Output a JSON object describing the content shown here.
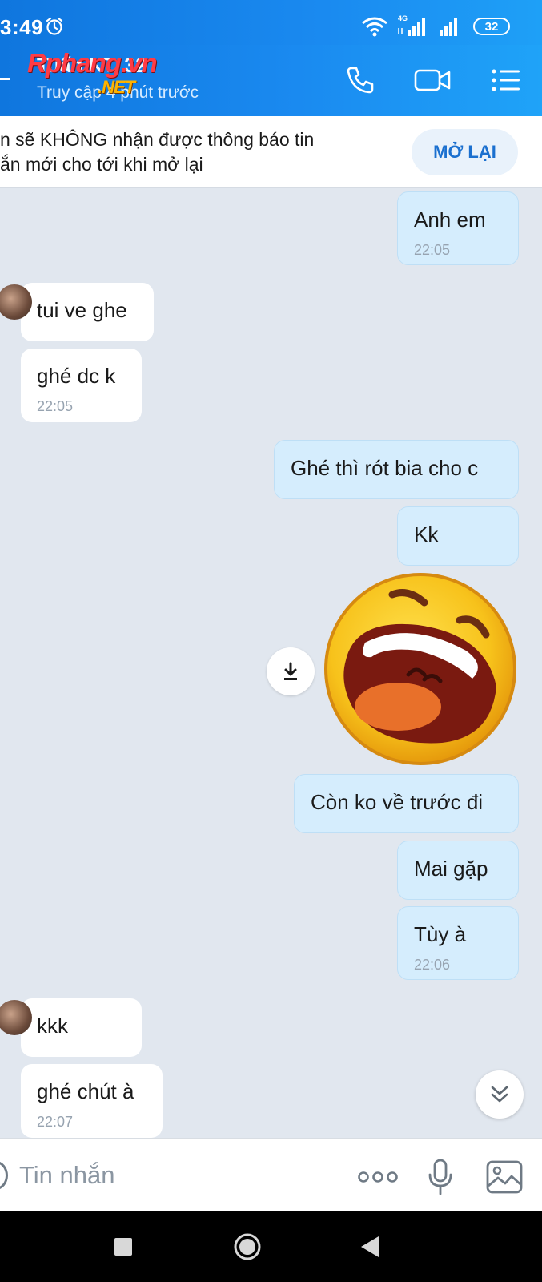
{
  "status_bar": {
    "time": "3:49",
    "network": "4G",
    "battery": "32"
  },
  "header": {
    "contact_name": "Tuấn KT. 32",
    "last_seen": "Truy cập 4 phút trước",
    "watermark_main": "Rphang.vn",
    "watermark_sub": ".NET",
    "icons": [
      "phone-icon",
      "video-call-icon",
      "menu-icon"
    ]
  },
  "notice": {
    "text": "n sẽ KHÔNG nhận được thông báo tin\nắn mới cho tới khi mở lại",
    "button": "MỞ LẠI"
  },
  "messages": [
    {
      "side": "sent",
      "text": "Anh em",
      "time": "22:05"
    },
    {
      "side": "recv",
      "text": "tui ve ghe",
      "time": ""
    },
    {
      "side": "recv",
      "text": "ghé dc k",
      "time": "22:05"
    },
    {
      "side": "sent",
      "text": "Ghé thì rót bia cho c",
      "time": ""
    },
    {
      "side": "sent",
      "text": "Kk",
      "time": ""
    },
    {
      "side": "sent",
      "text": "Còn ko về trước đi",
      "time": ""
    },
    {
      "side": "sent",
      "text": "Mai gặp",
      "time": ""
    },
    {
      "side": "sent",
      "text": "Tùy à",
      "time": "22:06"
    },
    {
      "side": "recv",
      "text": "kkk",
      "time": ""
    },
    {
      "side": "recv",
      "text": "ghé chút à",
      "time": "22:07"
    }
  ],
  "sticker": {
    "name": "laughing-face-sticker"
  },
  "input_bar": {
    "placeholder": "Tin nhắn",
    "icons": [
      "more-icon",
      "microphone-icon",
      "image-icon"
    ]
  },
  "nav_bar": {
    "icons": [
      "recents-icon",
      "home-icon",
      "back-icon"
    ]
  },
  "colors": {
    "header_blue": "#1a8af0",
    "sent_bubble": "#d5edfd",
    "recv_bubble": "#ffffff",
    "chat_bg": "#e1e7ef",
    "accent": "#1b70cf"
  }
}
